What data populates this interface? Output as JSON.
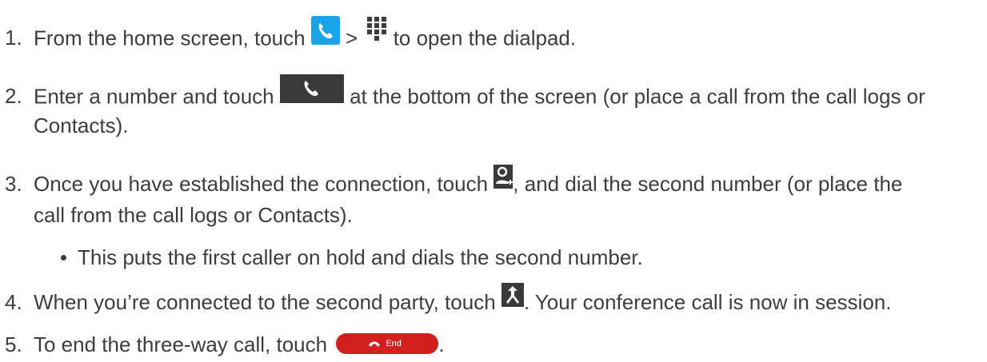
{
  "steps": [
    {
      "number": "1.",
      "before": "From the home screen, touch ",
      "middle": " > ",
      "after": " to open the dialpad."
    },
    {
      "number": "2.",
      "before": "Enter a number and touch ",
      "after": " at the bottom of the screen (or place a call from the call logs or",
      "continuation": "Contacts)."
    },
    {
      "number": "3.",
      "before": "Once you have established the connection, touch ",
      "after": ", and dial the second number (or place the",
      "continuation": "call from the call logs or Contacts)."
    },
    {
      "number": "4.",
      "before": "When you’re connected to the second party, touch ",
      "after": ". Your conference call is now in session."
    },
    {
      "number": "5.",
      "before": "To end the three-way call, touch ",
      "after": "."
    }
  ],
  "bullet": "This puts the first caller on hold and dials the second number.",
  "end_button_label": "End",
  "icons": [
    "phone-app-icon",
    "dialpad-icon",
    "call-button-icon",
    "add-call-icon",
    "merge-calls-icon",
    "end-call-button"
  ],
  "colors": {
    "text": "#3d3d3d",
    "phone_blue": "#1aa3e8",
    "call_gray": "#3a3a3a",
    "end_red": "#d3201f"
  }
}
